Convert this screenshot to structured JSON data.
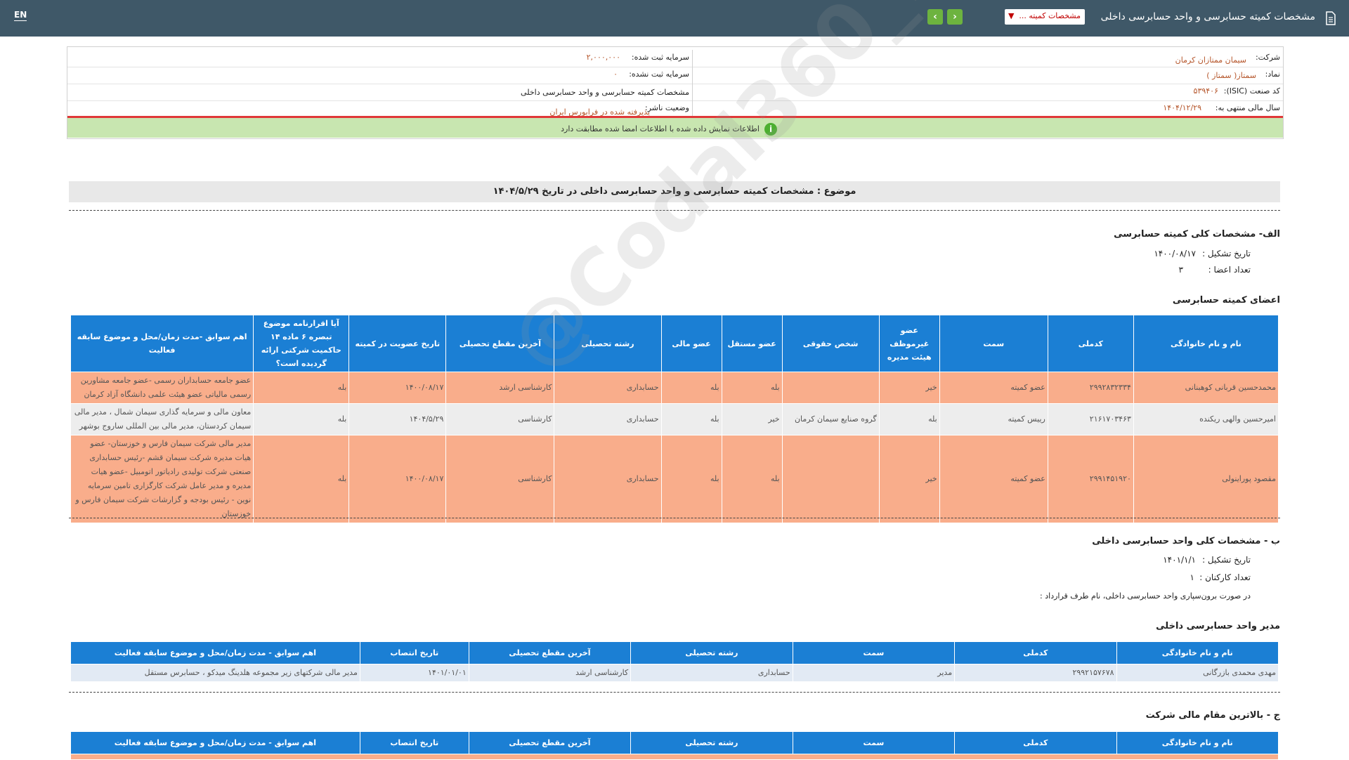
{
  "topbar": {
    "lang": "EN",
    "title": "مشخصات کمیته حسابرسی و واحد حسابرسی داخلی",
    "selector": "مشخصات کمیته ...",
    "prev_icon": "chevron-left-icon",
    "next_icon": "chevron-right-icon",
    "prev_glyph": "‹",
    "next_glyph": "›"
  },
  "company": {
    "company_label": "شرکت:",
    "company_value": "سیمان ممتازان کرمان",
    "symbol_label": "نماد:",
    "symbol_value": "سمتاز( سمتاز )",
    "isic_label": "کد صنعت (ISIC):",
    "isic_value": "۵۳۹۴۰۶",
    "fy_label": "سال مالی منتهی به:",
    "fy_value": "۱۴۰۴/۱۲/۲۹",
    "reg_capital_label": "سرمایه ثبت شده:",
    "reg_capital_value": "۲,۰۰۰,۰۰۰",
    "unreg_capital_label": "سرمایه ثبت نشده:",
    "unreg_capital_value": "۰",
    "report_title": "مشخصات کمیته حسابرسی و واحد حسابرسی داخلی",
    "publisher_label": "وضعیت ناشر:",
    "publisher_value": "پذیرفته شده در فرابورس ایران"
  },
  "notice": "اطلاعات نمایش داده شده با اطلاعات امضا شده مطابقت دارد",
  "subject": "موضوع : مشخصات کمیته حسابرسی و واحد حسابرسی داخلی در تاریخ ۱۴۰۴/۵/۲۹",
  "section_a": {
    "title": "الف- مشخصات کلی کمیته حسابرسی",
    "formation_label": "تاریخ تشکیل :",
    "formation_value": "۱۴۰۰/۰۸/۱۷",
    "members_count_label": "تعداد اعضا :",
    "members_count_value": "۳"
  },
  "committee_members": {
    "title": "اعضای کمیته حسابرسی",
    "headers": [
      "نام و نام خانوادگی",
      "کدملی",
      "سمت",
      "عضو غیرموظف هیئت مدیره",
      "شخص حقوقی",
      "عضو مستقل",
      "عضو مالی",
      "رشته تحصیلی",
      "آخرین مقطع تحصیلی",
      "تاریخ عضویت در کمیته",
      "آیا اقرارنامه موضوع تبصره ۶ ماده ۱۴ حاکمیت شرکتی ارائه گردیده است؟",
      "اهم سوابق -مدت زمان/محل و موضوع سابقه فعالیت"
    ],
    "rows": [
      [
        "محمدحسین قربانی کوهبنانی",
        "۲۹۹۲۸۳۲۳۳۴",
        "عضو کمیته",
        "خیر",
        "",
        "بله",
        "بله",
        "حسابداری",
        "کارشناسی ارشد",
        "۱۴۰۰/۰۸/۱۷",
        "بله",
        "عضو جامعه حسابداران رسمی -عضو جامعه مشاورین رسمی مالیاتی عضو هیئت علمی دانشگاه آزاد کرمان"
      ],
      [
        "امیرحسین والهی ریکنده",
        "۲۱۶۱۷۰۳۴۶۳",
        "رییس کمیته",
        "بله",
        "گروه صنایع سیمان کرمان",
        "خیر",
        "بله",
        "حسابداری",
        "کارشناسی",
        "۱۴۰۴/۵/۲۹",
        "بله",
        "معاون مالی و سرمایه گذاری سیمان شمال ، مدیر مالی سیمان کردستان، مدیر مالی بین المللی ساروج بوشهر"
      ],
      [
        "مقصود پوراینولی",
        "۲۹۹۱۴۵۱۹۲۰",
        "عضو کمیته",
        "خیر",
        "",
        "بله",
        "بله",
        "حسابداری",
        "کارشناسی",
        "۱۴۰۰/۰۸/۱۷",
        "بله",
        "مدیر مالی شرکت سیمان فارس و خوزستان- عضو هیات مدیره شرکت سیمان قشم -رئیس حسابداری صنعتی شرکت تولیدی رادیاتور اتومبیل -عضو هیات مدیره و مدیر عامل شرکت کارگزاری تامین سرمایه نوین - رئیس بودجه و گزارشات شرکت سیمان فارس و خوزستان"
      ]
    ]
  },
  "section_b": {
    "title": "ب - مشخصات کلی واحد حسابرسی داخلی",
    "formation_label": "تاریخ تشکیل :",
    "formation_value": "۱۴۰۱/۱/۱",
    "staff_label": "تعداد کارکنان :",
    "staff_value": "۱",
    "outsource_label": "در صورت برون‌سپاری واحد حسابرسی داخلی، نام طرف قرارداد :"
  },
  "internal_audit_manager": {
    "title": "مدیر واحد حسابرسی داخلی",
    "headers": [
      "نام و نام خانوادگی",
      "کدملی",
      "سمت",
      "رشته تحصیلی",
      "آخرین مقطع تحصیلی",
      "تاریخ انتصاب",
      "اهم سوابق - مدت زمان/محل و موضوع سابقه فعالیت"
    ],
    "rows": [
      [
        "مهدی محمدی بازرگانی",
        "۲۹۹۲۱۵۷۶۷۸",
        "مدیر",
        "حسابداری",
        "کارشناسی ارشد",
        "۱۴۰۱/۰۱/۰۱",
        "مدیر مالی شرکتهای زیر مجموعه هلدینگ میدکو ، حسابرس مستقل"
      ]
    ]
  },
  "section_c": {
    "title": "ج - بالاترین مقام مالی شرکت",
    "headers": [
      "نام و نام خانوادگی",
      "کدملی",
      "سمت",
      "رشته تحصیلی",
      "آخرین مقطع تحصیلی",
      "تاریخ انتصاب",
      "اهم سوابق - مدت زمان/محل و موضوع سابقه فعالیت"
    ]
  },
  "watermark": "@Codal360_ir",
  "colors": {
    "topbar": "#3f5868",
    "header_blue": "#1b7fd4",
    "row_orange": "#f9ad8b",
    "row_grey": "#ededed",
    "notice_green": "#c8e6b0",
    "accent_red": "#e03838",
    "value_orange": "#b5552a"
  }
}
